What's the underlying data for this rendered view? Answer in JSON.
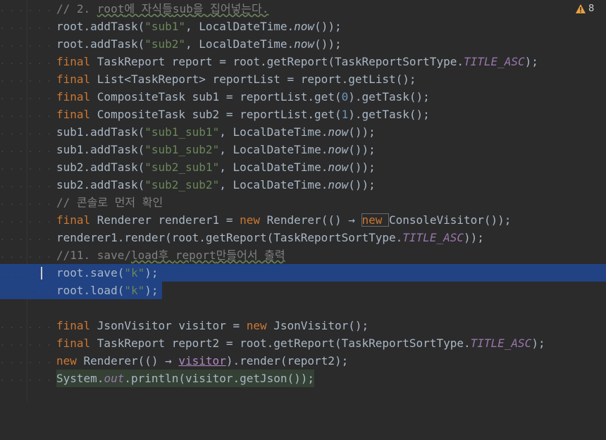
{
  "warnings": {
    "count": "8",
    "icon": "warning-triangle-icon"
  },
  "gutter_dots": ". . . . . . . . . . . .",
  "lines": [
    {
      "t": [
        "// 2. ",
        "root",
        "에 자식들",
        "sub",
        "을 집어넣는다."
      ]
    },
    {
      "t": [
        "root.addTask(",
        "\"sub1\"",
        ", LocalDateTime.",
        "now",
        "());"
      ]
    },
    {
      "t": [
        "root.addTask(",
        "\"sub2\"",
        ", LocalDateTime.",
        "now",
        "());"
      ]
    },
    {
      "t": [
        "final ",
        "TaskReport report = root.getReport(TaskReportSortType.",
        "TITLE_ASC",
        ");"
      ]
    },
    {
      "t": [
        "final ",
        "List<TaskReport> reportList = report.getList();"
      ]
    },
    {
      "t": [
        "final ",
        "CompositeTask sub1 = reportList.get(",
        "0",
        ").getTask();"
      ]
    },
    {
      "t": [
        "final ",
        "CompositeTask sub2 = reportList.get(",
        "1",
        ").getTask();"
      ]
    },
    {
      "t": [
        "sub1.addTask(",
        "\"sub1_sub1\"",
        ", LocalDateTime.",
        "now",
        "());"
      ]
    },
    {
      "t": [
        "sub1.addTask(",
        "\"sub1_sub2\"",
        ", LocalDateTime.",
        "now",
        "());"
      ]
    },
    {
      "t": [
        "sub2.addTask(",
        "\"sub2_sub1\"",
        ", LocalDateTime.",
        "now",
        "());"
      ]
    },
    {
      "t": [
        "sub2.addTask(",
        "\"sub2_sub2\"",
        ", LocalDateTime.",
        "now",
        "());"
      ]
    },
    {
      "t": [
        "// 콘솔로 먼저 확인"
      ]
    },
    {
      "t": [
        "final ",
        "Renderer renderer1 = ",
        "new ",
        "Renderer(() → ",
        "new ",
        "ConsoleVisitor",
        "());"
      ]
    },
    {
      "t": [
        "renderer1.render(root.getReport(TaskReportSortType.",
        "TITLE_ASC",
        "));"
      ]
    },
    {
      "t": [
        "//11. save/",
        "load",
        "후 ",
        "report",
        "만들어서 출력"
      ]
    },
    {
      "t": [
        "root.save(",
        "\"k\"",
        ");"
      ]
    },
    {
      "t": [
        "root.load(",
        "\"k\"",
        ");"
      ]
    },
    {
      "t": [
        ""
      ]
    },
    {
      "t": [
        "final ",
        "JsonVisitor visitor = ",
        "new ",
        "JsonVisitor();"
      ]
    },
    {
      "t": [
        "final ",
        "TaskReport report2 = root.getReport(TaskReportSortType.",
        "TITLE_ASC",
        ");"
      ]
    },
    {
      "t": [
        "new ",
        "Renderer(() → ",
        "visitor",
        ").render(report2);"
      ]
    },
    {
      "t": [
        "System.",
        "out",
        ".println(visitor.getJson());"
      ]
    }
  ]
}
